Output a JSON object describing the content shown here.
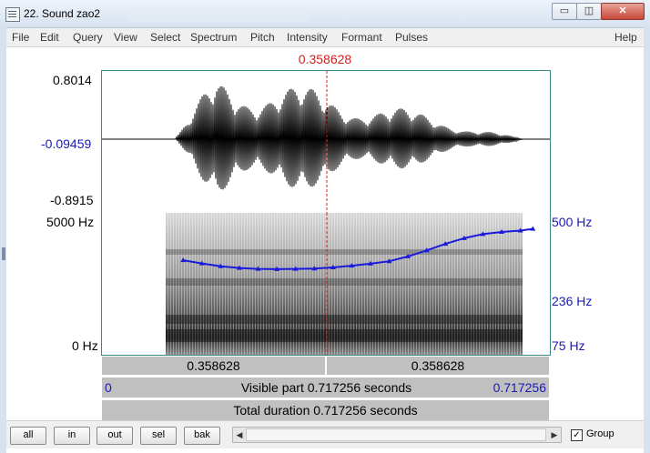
{
  "window": {
    "title": "22. Sound zao2",
    "min_glyph": "▭",
    "max_glyph": "◫",
    "close_glyph": "✕"
  },
  "menu": [
    "File",
    "Edit",
    "Query",
    "View",
    "Select",
    "Spectrum",
    "Pitch",
    "Intensity",
    "Formant",
    "Pulses",
    "Help"
  ],
  "cursor_time": "0.358628",
  "waveform": {
    "y_max": "0.8014",
    "y_cursor": "-0.09459",
    "y_min": "-0.8915"
  },
  "spectrogram": {
    "freq_max": "5000 Hz",
    "freq_min": "0 Hz",
    "pitch_max": "500 Hz",
    "pitch_cursor": "236 Hz",
    "pitch_min": "75 Hz"
  },
  "time_bar": {
    "left_value": "0.358628",
    "right_value": "0.358628"
  },
  "visible_bar": {
    "start": "0",
    "label": "Visible part 0.717256 seconds",
    "end": "0.717256"
  },
  "total_bar": {
    "label": "Total duration 0.717256 seconds"
  },
  "toolbar": {
    "buttons": [
      "all",
      "in",
      "out",
      "sel",
      "bak"
    ],
    "group_label": "Group",
    "group_checked": "✓"
  },
  "colors": {
    "cursor": "#d42020",
    "pitch_track": "#1a1adc",
    "axis_blue": "#1a1ab4",
    "panel_border": "#3a8a8a"
  },
  "chart_data": {
    "type": "line",
    "x_range": [
      0,
      0.717256
    ],
    "pitch_range_hz": [
      75,
      500
    ],
    "cursor_time": 0.358628,
    "pitch_track": {
      "x": [
        0.13,
        0.16,
        0.19,
        0.22,
        0.25,
        0.28,
        0.31,
        0.34,
        0.37,
        0.4,
        0.43,
        0.46,
        0.49,
        0.52,
        0.55,
        0.58,
        0.61,
        0.64,
        0.67,
        0.69
      ],
      "y": [
        270,
        258,
        248,
        242,
        239,
        238,
        239,
        240,
        244,
        250,
        257,
        266,
        285,
        310,
        340,
        368,
        390,
        402,
        410,
        420
      ]
    }
  }
}
